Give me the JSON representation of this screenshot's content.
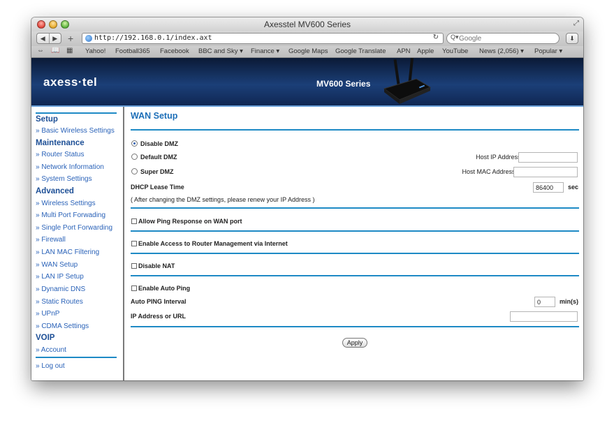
{
  "window": {
    "title": "Axesstel MV600 Series"
  },
  "toolbar": {
    "back": "◀",
    "forward": "▶",
    "new_tab": "+",
    "url": "http://192.168.0.1/index.axt",
    "reload": "↻",
    "search_placeholder": "Google",
    "search_icon": "Q▾"
  },
  "bookmarks": [
    "Yahoo!",
    "Football365",
    "Facebook",
    "BBC and Sky ▾",
    "Finance ▾",
    "Google Maps",
    "Google Translate",
    "APN",
    "Apple",
    "YouTube",
    "News (2,056) ▾",
    "Popular ▾"
  ],
  "banner": {
    "logo": "axess·tel",
    "model": "MV600 Series"
  },
  "sidebar": {
    "setup": {
      "heading": "Setup",
      "links": [
        "» Basic Wireless Settings"
      ]
    },
    "maintenance": {
      "heading": "Maintenance",
      "links": [
        "» Router Status",
        "» Network Information",
        "» System Settings"
      ]
    },
    "advanced": {
      "heading": "Advanced",
      "links": [
        "» Wireless Settings",
        "» Multi Port Forwading",
        "» Single Port Forwarding",
        "» Firewall",
        "» LAN MAC Filtering",
        "» WAN Setup",
        "» LAN IP Setup",
        "» Dynamic DNS",
        "» Static Routes",
        "» UPnP",
        "» CDMA Settings"
      ]
    },
    "voip": {
      "heading": "VOIP",
      "links": [
        "» Account"
      ]
    },
    "logout": "» Log out"
  },
  "main": {
    "title": "WAN Setup",
    "dmz": {
      "disable": "Disable DMZ",
      "default": "Default DMZ",
      "super": "Super DMZ",
      "host_ip_label": "Host IP Address:",
      "host_ip_value": "",
      "host_mac_label": "Host MAC Address:",
      "host_mac_value": ""
    },
    "dhcp": {
      "label": "DHCP Lease Time",
      "value": "86400",
      "unit": "sec"
    },
    "note": "( After changing the DMZ settings, please renew your IP Address )",
    "allow_ping": "Allow Ping Response on WAN port",
    "enable_access": "Enable Access to Router Management via Internet",
    "disable_nat": "Disable NAT",
    "auto_ping": {
      "enable": "Enable Auto Ping",
      "interval_label": "Auto PING Interval",
      "interval_value": "0",
      "interval_unit": "min(s)",
      "ip_label": "IP Address or URL",
      "ip_value": ""
    },
    "apply": "Apply"
  }
}
